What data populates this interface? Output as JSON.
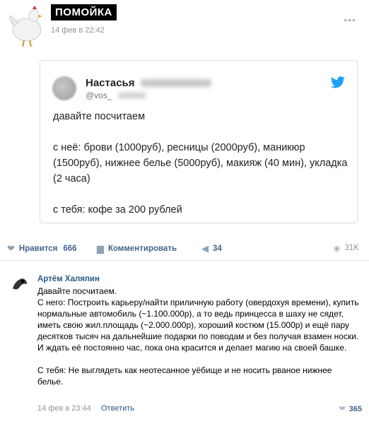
{
  "header": {
    "group_name": "ПОМОЙКА",
    "date": "14 фев в 22:42",
    "more_icon": "more-dots-icon"
  },
  "tweet": {
    "name": "Настасья",
    "handle": "@vos_",
    "brand_color": "#1da1f2",
    "paragraphs": [
      "давайте посчитаем",
      "с неё: брови (1000руб), ресницы (2000руб), маникюр (1500руб), нижнее белье (5000руб), макияж (40 мин), укладка (2 часа)",
      "с тебя: кофе за 200 рублей"
    ]
  },
  "actions": {
    "like_label": "Нравится",
    "like_count": "666",
    "comment_label": "Комментировать",
    "share_count": "34",
    "views": "31K"
  },
  "comment": {
    "author": "Артём Халяпин",
    "lines": [
      "Давайте посчитаем.",
      "С него: Построить карьеру/найти приличную работу (овердохуя времени), купить нормальные автомобиль (~1.100.000р), а то ведь принцесса в шаху не сядет, иметь свою жил.площадь (~2.000.000р), хороший костюм (15.000р) и ещё пару десятков тысяч на дальнейшие подарки по поводам и без получая взамен носки. И ждать её постоянно час, пока она красится и делает магию на своей башке.",
      "С тебя: Не выглядеть как неотесанное уёбище и не носить рваное нижнее белье."
    ],
    "date": "14 фев в 23:44",
    "reply_label": "Ответить",
    "likes": "365"
  }
}
